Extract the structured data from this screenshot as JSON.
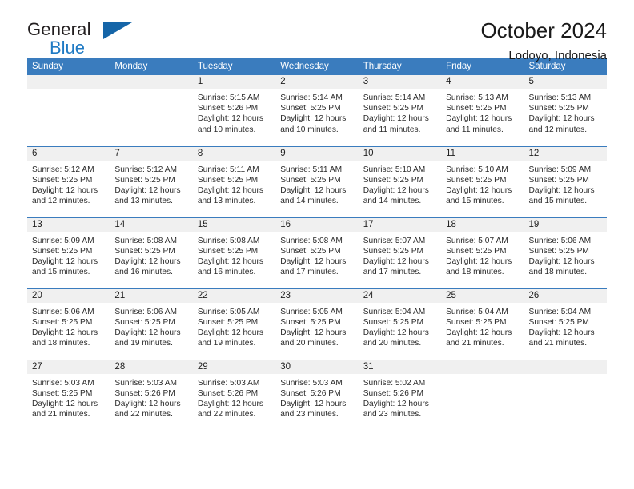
{
  "brand": {
    "name_part1": "General",
    "name_part2": "Blue",
    "colors": {
      "dark": "#231f20",
      "blue": "#1f7ac4",
      "triangle": "#1565a8"
    }
  },
  "header": {
    "title": "October 2024",
    "subtitle": "Lodoyo, Indonesia"
  },
  "theme": {
    "header_row_bg": "#3a7cbe",
    "daynum_bg": "#f0f0f0",
    "grid_line": "#3a7cbe",
    "text": "#222222"
  },
  "weekdays": [
    "Sunday",
    "Monday",
    "Tuesday",
    "Wednesday",
    "Thursday",
    "Friday",
    "Saturday"
  ],
  "weeks": [
    [
      {
        "day": "",
        "blank": true,
        "sunrise": "",
        "sunset": "",
        "daylight1": "",
        "daylight2": ""
      },
      {
        "day": "",
        "blank": true,
        "sunrise": "",
        "sunset": "",
        "daylight1": "",
        "daylight2": ""
      },
      {
        "day": "1",
        "sunrise": "Sunrise: 5:15 AM",
        "sunset": "Sunset: 5:26 PM",
        "daylight1": "Daylight: 12 hours",
        "daylight2": "and 10 minutes."
      },
      {
        "day": "2",
        "sunrise": "Sunrise: 5:14 AM",
        "sunset": "Sunset: 5:25 PM",
        "daylight1": "Daylight: 12 hours",
        "daylight2": "and 10 minutes."
      },
      {
        "day": "3",
        "sunrise": "Sunrise: 5:14 AM",
        "sunset": "Sunset: 5:25 PM",
        "daylight1": "Daylight: 12 hours",
        "daylight2": "and 11 minutes."
      },
      {
        "day": "4",
        "sunrise": "Sunrise: 5:13 AM",
        "sunset": "Sunset: 5:25 PM",
        "daylight1": "Daylight: 12 hours",
        "daylight2": "and 11 minutes."
      },
      {
        "day": "5",
        "sunrise": "Sunrise: 5:13 AM",
        "sunset": "Sunset: 5:25 PM",
        "daylight1": "Daylight: 12 hours",
        "daylight2": "and 12 minutes."
      }
    ],
    [
      {
        "day": "6",
        "sunrise": "Sunrise: 5:12 AM",
        "sunset": "Sunset: 5:25 PM",
        "daylight1": "Daylight: 12 hours",
        "daylight2": "and 12 minutes."
      },
      {
        "day": "7",
        "sunrise": "Sunrise: 5:12 AM",
        "sunset": "Sunset: 5:25 PM",
        "daylight1": "Daylight: 12 hours",
        "daylight2": "and 13 minutes."
      },
      {
        "day": "8",
        "sunrise": "Sunrise: 5:11 AM",
        "sunset": "Sunset: 5:25 PM",
        "daylight1": "Daylight: 12 hours",
        "daylight2": "and 13 minutes."
      },
      {
        "day": "9",
        "sunrise": "Sunrise: 5:11 AM",
        "sunset": "Sunset: 5:25 PM",
        "daylight1": "Daylight: 12 hours",
        "daylight2": "and 14 minutes."
      },
      {
        "day": "10",
        "sunrise": "Sunrise: 5:10 AM",
        "sunset": "Sunset: 5:25 PM",
        "daylight1": "Daylight: 12 hours",
        "daylight2": "and 14 minutes."
      },
      {
        "day": "11",
        "sunrise": "Sunrise: 5:10 AM",
        "sunset": "Sunset: 5:25 PM",
        "daylight1": "Daylight: 12 hours",
        "daylight2": "and 15 minutes."
      },
      {
        "day": "12",
        "sunrise": "Sunrise: 5:09 AM",
        "sunset": "Sunset: 5:25 PM",
        "daylight1": "Daylight: 12 hours",
        "daylight2": "and 15 minutes."
      }
    ],
    [
      {
        "day": "13",
        "sunrise": "Sunrise: 5:09 AM",
        "sunset": "Sunset: 5:25 PM",
        "daylight1": "Daylight: 12 hours",
        "daylight2": "and 15 minutes."
      },
      {
        "day": "14",
        "sunrise": "Sunrise: 5:08 AM",
        "sunset": "Sunset: 5:25 PM",
        "daylight1": "Daylight: 12 hours",
        "daylight2": "and 16 minutes."
      },
      {
        "day": "15",
        "sunrise": "Sunrise: 5:08 AM",
        "sunset": "Sunset: 5:25 PM",
        "daylight1": "Daylight: 12 hours",
        "daylight2": "and 16 minutes."
      },
      {
        "day": "16",
        "sunrise": "Sunrise: 5:08 AM",
        "sunset": "Sunset: 5:25 PM",
        "daylight1": "Daylight: 12 hours",
        "daylight2": "and 17 minutes."
      },
      {
        "day": "17",
        "sunrise": "Sunrise: 5:07 AM",
        "sunset": "Sunset: 5:25 PM",
        "daylight1": "Daylight: 12 hours",
        "daylight2": "and 17 minutes."
      },
      {
        "day": "18",
        "sunrise": "Sunrise: 5:07 AM",
        "sunset": "Sunset: 5:25 PM",
        "daylight1": "Daylight: 12 hours",
        "daylight2": "and 18 minutes."
      },
      {
        "day": "19",
        "sunrise": "Sunrise: 5:06 AM",
        "sunset": "Sunset: 5:25 PM",
        "daylight1": "Daylight: 12 hours",
        "daylight2": "and 18 minutes."
      }
    ],
    [
      {
        "day": "20",
        "sunrise": "Sunrise: 5:06 AM",
        "sunset": "Sunset: 5:25 PM",
        "daylight1": "Daylight: 12 hours",
        "daylight2": "and 18 minutes."
      },
      {
        "day": "21",
        "sunrise": "Sunrise: 5:06 AM",
        "sunset": "Sunset: 5:25 PM",
        "daylight1": "Daylight: 12 hours",
        "daylight2": "and 19 minutes."
      },
      {
        "day": "22",
        "sunrise": "Sunrise: 5:05 AM",
        "sunset": "Sunset: 5:25 PM",
        "daylight1": "Daylight: 12 hours",
        "daylight2": "and 19 minutes."
      },
      {
        "day": "23",
        "sunrise": "Sunrise: 5:05 AM",
        "sunset": "Sunset: 5:25 PM",
        "daylight1": "Daylight: 12 hours",
        "daylight2": "and 20 minutes."
      },
      {
        "day": "24",
        "sunrise": "Sunrise: 5:04 AM",
        "sunset": "Sunset: 5:25 PM",
        "daylight1": "Daylight: 12 hours",
        "daylight2": "and 20 minutes."
      },
      {
        "day": "25",
        "sunrise": "Sunrise: 5:04 AM",
        "sunset": "Sunset: 5:25 PM",
        "daylight1": "Daylight: 12 hours",
        "daylight2": "and 21 minutes."
      },
      {
        "day": "26",
        "sunrise": "Sunrise: 5:04 AM",
        "sunset": "Sunset: 5:25 PM",
        "daylight1": "Daylight: 12 hours",
        "daylight2": "and 21 minutes."
      }
    ],
    [
      {
        "day": "27",
        "sunrise": "Sunrise: 5:03 AM",
        "sunset": "Sunset: 5:25 PM",
        "daylight1": "Daylight: 12 hours",
        "daylight2": "and 21 minutes."
      },
      {
        "day": "28",
        "sunrise": "Sunrise: 5:03 AM",
        "sunset": "Sunset: 5:26 PM",
        "daylight1": "Daylight: 12 hours",
        "daylight2": "and 22 minutes."
      },
      {
        "day": "29",
        "sunrise": "Sunrise: 5:03 AM",
        "sunset": "Sunset: 5:26 PM",
        "daylight1": "Daylight: 12 hours",
        "daylight2": "and 22 minutes."
      },
      {
        "day": "30",
        "sunrise": "Sunrise: 5:03 AM",
        "sunset": "Sunset: 5:26 PM",
        "daylight1": "Daylight: 12 hours",
        "daylight2": "and 23 minutes."
      },
      {
        "day": "31",
        "sunrise": "Sunrise: 5:02 AM",
        "sunset": "Sunset: 5:26 PM",
        "daylight1": "Daylight: 12 hours",
        "daylight2": "and 23 minutes."
      },
      {
        "day": "",
        "blank": true,
        "sunrise": "",
        "sunset": "",
        "daylight1": "",
        "daylight2": ""
      },
      {
        "day": "",
        "blank": true,
        "sunrise": "",
        "sunset": "",
        "daylight1": "",
        "daylight2": ""
      }
    ]
  ]
}
